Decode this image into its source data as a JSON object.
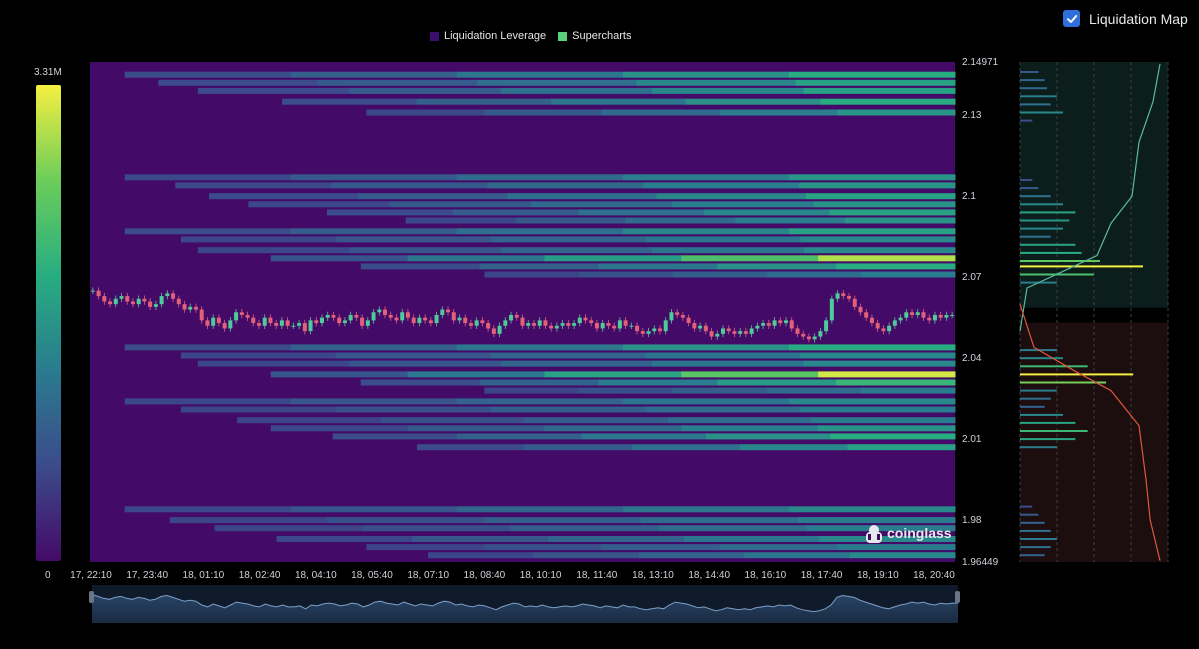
{
  "legend": {
    "items": [
      {
        "label": "Liquidation Leverage",
        "color": "#3b0f70"
      },
      {
        "label": "Supercharts",
        "color": "#5ad07a"
      }
    ]
  },
  "toggle": {
    "label": "Liquidation Map",
    "checked": true,
    "icon": "check-icon",
    "color": "#2f6fdc"
  },
  "colorscale": {
    "max_label": "3.31M",
    "min_label": "0",
    "stops": [
      "#440a68",
      "#3b4b8b",
      "#2a7b8e",
      "#27ad81",
      "#6ccd5a",
      "#f5ef40"
    ]
  },
  "watermark": "coinglass",
  "chart_data": [
    {
      "type": "heatmap",
      "title": "",
      "xlabel": "",
      "ylabel": "",
      "x_ticks": [
        "17, 22:10",
        "17, 23:40",
        "18, 01:10",
        "18, 02:40",
        "18, 04:10",
        "18, 05:40",
        "18, 07:10",
        "18, 08:40",
        "18, 10:10",
        "18, 11:40",
        "18, 13:10",
        "18, 14:40",
        "18, 16:10",
        "18, 17:40",
        "18, 19:10",
        "18, 20:40"
      ],
      "y_ticks": [
        "2.14971",
        "2.13",
        "2.1",
        "2.07",
        "2.04",
        "2.01",
        "1.98",
        "1.96449"
      ],
      "ylim": [
        1.96449,
        2.14971
      ],
      "xlim": [
        "17, 21:30",
        "18, 21:30"
      ],
      "background_value": 0,
      "levels": [
        {
          "price": 2.145,
          "start_tick": 0.6,
          "value": 0.6
        },
        {
          "price": 2.142,
          "start_tick": 1.2,
          "value": 0.55
        },
        {
          "price": 2.139,
          "start_tick": 1.9,
          "value": 0.55
        },
        {
          "price": 2.135,
          "start_tick": 3.4,
          "value": 0.6
        },
        {
          "price": 2.131,
          "start_tick": 4.9,
          "value": 0.5
        },
        {
          "price": 2.107,
          "start_tick": 0.6,
          "value": 0.5
        },
        {
          "price": 2.104,
          "start_tick": 1.5,
          "value": 0.5
        },
        {
          "price": 2.1,
          "start_tick": 2.1,
          "value": 0.55
        },
        {
          "price": 2.097,
          "start_tick": 2.8,
          "value": 0.5
        },
        {
          "price": 2.094,
          "start_tick": 4.2,
          "value": 0.55
        },
        {
          "price": 2.091,
          "start_tick": 5.6,
          "value": 0.5
        },
        {
          "price": 2.087,
          "start_tick": 0.6,
          "value": 0.55
        },
        {
          "price": 2.084,
          "start_tick": 1.6,
          "value": 0.45
        },
        {
          "price": 2.08,
          "start_tick": 1.9,
          "value": 0.45
        },
        {
          "price": 2.077,
          "start_tick": 3.2,
          "value": 0.9
        },
        {
          "price": 2.074,
          "start_tick": 4.8,
          "value": 0.6
        },
        {
          "price": 2.071,
          "start_tick": 7.0,
          "value": 0.4
        },
        {
          "price": 2.044,
          "start_tick": 0.6,
          "value": 0.6
        },
        {
          "price": 2.041,
          "start_tick": 1.6,
          "value": 0.45
        },
        {
          "price": 2.038,
          "start_tick": 1.9,
          "value": 0.45
        },
        {
          "price": 2.034,
          "start_tick": 3.2,
          "value": 0.95
        },
        {
          "price": 2.031,
          "start_tick": 4.8,
          "value": 0.65
        },
        {
          "price": 2.028,
          "start_tick": 7.0,
          "value": 0.4
        },
        {
          "price": 2.024,
          "start_tick": 0.6,
          "value": 0.45
        },
        {
          "price": 2.021,
          "start_tick": 1.6,
          "value": 0.4
        },
        {
          "price": 2.017,
          "start_tick": 2.6,
          "value": 0.4
        },
        {
          "price": 2.014,
          "start_tick": 3.2,
          "value": 0.5
        },
        {
          "price": 2.011,
          "start_tick": 4.3,
          "value": 0.6
        },
        {
          "price": 2.007,
          "start_tick": 5.8,
          "value": 0.55
        },
        {
          "price": 1.984,
          "start_tick": 0.6,
          "value": 0.45
        },
        {
          "price": 1.98,
          "start_tick": 1.4,
          "value": 0.4
        },
        {
          "price": 1.977,
          "start_tick": 2.2,
          "value": 0.4
        },
        {
          "price": 1.973,
          "start_tick": 3.3,
          "value": 0.45
        },
        {
          "price": 1.97,
          "start_tick": 4.9,
          "value": 0.4
        },
        {
          "price": 1.967,
          "start_tick": 6.0,
          "value": 0.45
        }
      ],
      "price_candles_close": [
        2.065,
        2.063,
        2.061,
        2.06,
        2.062,
        2.063,
        2.061,
        2.06,
        2.062,
        2.061,
        2.059,
        2.06,
        2.063,
        2.064,
        2.062,
        2.06,
        2.058,
        2.059,
        2.058,
        2.054,
        2.052,
        2.055,
        2.053,
        2.051,
        2.054,
        2.057,
        2.056,
        2.055,
        2.053,
        2.052,
        2.055,
        2.053,
        2.052,
        2.054,
        2.052,
        2.052,
        2.053,
        2.05,
        2.054,
        2.053,
        2.055,
        2.056,
        2.055,
        2.053,
        2.054,
        2.056,
        2.055,
        2.052,
        2.054,
        2.057,
        2.058,
        2.056,
        2.055,
        2.054,
        2.057,
        2.055,
        2.053,
        2.055,
        2.054,
        2.053,
        2.056,
        2.058,
        2.057,
        2.054,
        2.055,
        2.053,
        2.052,
        2.054,
        2.053,
        2.051,
        2.049,
        2.052,
        2.054,
        2.056,
        2.055,
        2.052,
        2.053,
        2.052,
        2.054,
        2.052,
        2.051,
        2.052,
        2.053,
        2.052,
        2.053,
        2.055,
        2.054,
        2.053,
        2.051,
        2.053,
        2.052,
        2.051,
        2.054,
        2.052,
        2.052,
        2.05,
        2.049,
        2.05,
        2.051,
        2.05,
        2.054,
        2.057,
        2.056,
        2.055,
        2.053,
        2.051,
        2.052,
        2.05,
        2.048,
        2.049,
        2.051,
        2.05,
        2.049,
        2.05,
        2.049,
        2.051,
        2.052,
        2.053,
        2.052,
        2.054,
        2.053,
        2.054,
        2.051,
        2.049,
        2.048,
        2.047,
        2.048,
        2.05,
        2.054,
        2.062,
        2.064,
        2.063,
        2.062,
        2.059,
        2.057,
        2.055,
        2.053,
        2.051,
        2.05,
        2.052,
        2.054,
        2.055,
        2.057,
        2.056,
        2.057,
        2.055,
        2.054,
        2.056,
        2.055,
        2.056,
        2.056
      ],
      "timeline_overview": true
    },
    {
      "type": "bar",
      "title": "",
      "orientation": "horizontal",
      "ylim": [
        1.96449,
        2.14971
      ],
      "current_price": 2.055,
      "short_side_color": "#5ab9a0",
      "long_side_color": "#e0573f",
      "bars_above": [
        {
          "price": 2.146,
          "value": 0.15
        },
        {
          "price": 2.143,
          "value": 0.2
        },
        {
          "price": 2.14,
          "value": 0.22
        },
        {
          "price": 2.137,
          "value": 0.3
        },
        {
          "price": 2.134,
          "value": 0.25
        },
        {
          "price": 2.131,
          "value": 0.35
        },
        {
          "price": 2.128,
          "value": 0.1
        },
        {
          "price": 2.106,
          "value": 0.1
        },
        {
          "price": 2.103,
          "value": 0.15
        },
        {
          "price": 2.1,
          "value": 0.25
        },
        {
          "price": 2.097,
          "value": 0.35
        },
        {
          "price": 2.094,
          "value": 0.45
        },
        {
          "price": 2.091,
          "value": 0.4
        },
        {
          "price": 2.088,
          "value": 0.35
        },
        {
          "price": 2.085,
          "value": 0.25
        },
        {
          "price": 2.082,
          "value": 0.45
        },
        {
          "price": 2.079,
          "value": 0.5
        },
        {
          "price": 2.076,
          "value": 0.65
        },
        {
          "price": 2.074,
          "value": 1.0
        },
        {
          "price": 2.071,
          "value": 0.6
        },
        {
          "price": 2.068,
          "value": 0.3
        }
      ],
      "bars_below": [
        {
          "price": 2.043,
          "value": 0.3
        },
        {
          "price": 2.04,
          "value": 0.35
        },
        {
          "price": 2.037,
          "value": 0.55
        },
        {
          "price": 2.034,
          "value": 0.92
        },
        {
          "price": 2.031,
          "value": 0.7
        },
        {
          "price": 2.028,
          "value": 0.3
        },
        {
          "price": 2.025,
          "value": 0.25
        },
        {
          "price": 2.022,
          "value": 0.2
        },
        {
          "price": 2.019,
          "value": 0.35
        },
        {
          "price": 2.016,
          "value": 0.45
        },
        {
          "price": 2.013,
          "value": 0.55
        },
        {
          "price": 2.01,
          "value": 0.45
        },
        {
          "price": 2.007,
          "value": 0.3
        },
        {
          "price": 1.985,
          "value": 0.1
        },
        {
          "price": 1.982,
          "value": 0.15
        },
        {
          "price": 1.979,
          "value": 0.2
        },
        {
          "price": 1.976,
          "value": 0.25
        },
        {
          "price": 1.973,
          "value": 0.3
        },
        {
          "price": 1.97,
          "value": 0.25
        },
        {
          "price": 1.967,
          "value": 0.2
        }
      ],
      "cumulative_above": [
        {
          "price": 2.05,
          "value": 0.0
        },
        {
          "price": 2.066,
          "value": 0.05
        },
        {
          "price": 2.072,
          "value": 0.3
        },
        {
          "price": 2.078,
          "value": 0.55
        },
        {
          "price": 2.09,
          "value": 0.65
        },
        {
          "price": 2.1,
          "value": 0.8
        },
        {
          "price": 2.12,
          "value": 0.85
        },
        {
          "price": 2.135,
          "value": 0.95
        },
        {
          "price": 2.149,
          "value": 1.0
        }
      ],
      "cumulative_below": [
        {
          "price": 2.06,
          "value": 0.0
        },
        {
          "price": 2.044,
          "value": 0.1
        },
        {
          "price": 2.035,
          "value": 0.4
        },
        {
          "price": 2.028,
          "value": 0.65
        },
        {
          "price": 2.015,
          "value": 0.85
        },
        {
          "price": 1.995,
          "value": 0.9
        },
        {
          "price": 1.98,
          "value": 0.93
        },
        {
          "price": 1.965,
          "value": 1.0
        }
      ]
    }
  ]
}
